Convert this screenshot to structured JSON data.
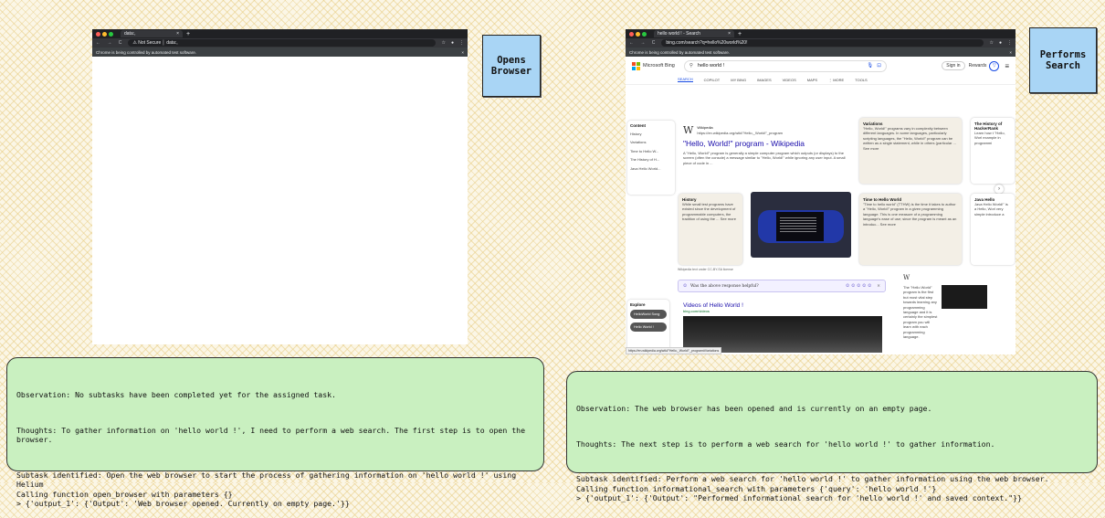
{
  "step1": {
    "note_label": "Opens\nBrowser",
    "browser": {
      "tab_title": "data:,",
      "new_tab": "+",
      "nav_icons": "← → C",
      "security_label": "Not Secure",
      "url": "data:,",
      "infobar_text": "Chrome is being controlled by automated test software.",
      "infobar_close": "×"
    },
    "console": {
      "observation": "Observation: No subtasks have been completed yet for the assigned task.",
      "thoughts": "Thoughts: To gather information on 'hello world !', I need to perform a web search. The first step is to open the browser.",
      "subtask": "Subtask identified: Open the web browser to start the process of gathering information on 'hello world !' using Helium\nCalling function open_browser with parameters {}\n> {'output_1': {'Output': 'Web browser opened. Currently on empty page.'}}"
    }
  },
  "step2": {
    "note_label": "Performs\nSearch",
    "browser": {
      "tab_title": "hello world ! - Search",
      "new_tab": "+",
      "nav_icons": "← → C",
      "url": "bing.com/search?q=hello%20world%20!",
      "infobar_text": "Chrome is being controlled by automated test software.",
      "infobar_close": "×"
    },
    "bing": {
      "logo_text": "Microsoft Bing",
      "query": "hello world !",
      "sign_in": "Sign in",
      "rewards": "Rewards",
      "tabs": [
        "SEARCH",
        "COPILOT",
        "MY BING",
        "IMAGES",
        "VIDEOS",
        "MAPS",
        "⋮ MORE",
        "TOOLS"
      ],
      "content_heading": "Content",
      "content_items": [
        "History",
        "Variations",
        "Time to Hello W...",
        "The History of H...",
        "Java Hello World..."
      ],
      "wiki_source": "Wikipedia",
      "wiki_url": "https://en.wikipedia.org/wiki/\"Hello,_World!\"_program",
      "wiki_title": "\"Hello, World!\" program - Wikipedia",
      "wiki_snippet": "A \"Hello, World!\" program is generally a simple computer program which outputs (or displays) to the screen (often the console) a message similar to \"Hello, World!\" while ignoring any user input. A small piece of code in ...",
      "variations_title": "Variations",
      "variations_text": "\"Hello, World!\" programs vary in complexity between different languages. In some languages, particularly scripting languages, the \"Hello, World!\" program can be written as a single statement, while in others (particular ... See more",
      "history_title": "History",
      "history_text": "While small test programs have existed since the development of programmable computers, the tradition of using the ... See more",
      "time_title": "Time to Hello World",
      "time_text": "\"Time to hello world\" (TTHW) is the time it takes to author a \"Hello, World!\" program in a given programming language. This is one measure of a programming language's ease of use; since the program is meant as an introduc... See more",
      "side_title": "The History of HackerRank",
      "side_text": "Learn how t \"Hello, Worl example in programmi",
      "java_title": "Java Hello",
      "java_text": "Java Hello World!\" is a Hello, Worl very simple introduce a",
      "license_text": "Wikipedia text under CC-BY-SA license",
      "feedback_text": "Was the above response helpful?",
      "explore_heading": "Explore",
      "explore_items": [
        "HelloWorld Song",
        "Hello World !"
      ],
      "videos_title": "Videos of Hello World !",
      "videos_url": "bing.com/videos",
      "rp_text": "The \"Hello World\" program is the first but most vital step towards learning any programming language and it is certainly the simplest program you will learn with each programming language.",
      "status_url": "https://en.wikipedia.org/wiki/\"Hello,_World!\"_program#Variations"
    },
    "console": {
      "observation": "Observation: The web browser has been opened and is currently on an empty page.",
      "thoughts": "Thoughts: The next step is to perform a web search for 'hello world !' to gather information.",
      "subtask": "Subtask identified: Perform a web search for 'hello world !' to gather information using the web browser.\nCalling function informational_search with parameters {'query': 'hello world !'}\n> {'output_1': {'Output': \"Performed informational search for 'hello world !' and saved context.\"}}"
    }
  }
}
